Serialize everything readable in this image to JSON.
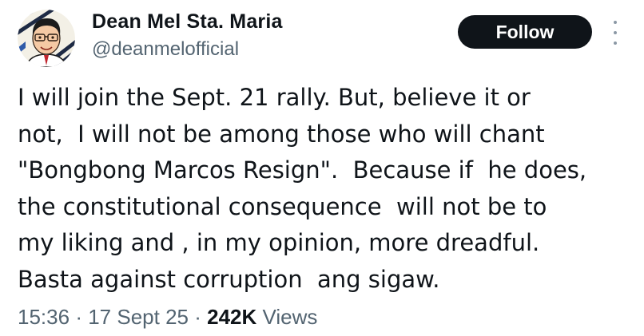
{
  "author": {
    "name": "Dean Mel Sta. Maria",
    "handle": "@deanmelofficial",
    "avatar_icon": "caricature-avatar-icon"
  },
  "actions": {
    "follow_label": "Follow",
    "more_icon": "more-vertical-icon"
  },
  "tweet": {
    "lines": [
      "I will join the Sept. 21 rally. But, believe it or",
      "not,  I will not be among those who will chant",
      "\"Bongbong Marcos Resign\".  Because if  he does,",
      "the constitutional consequence  will not be to",
      "my liking and , in my opinion, more dreadful.",
      "Basta against corruption  ang sigaw."
    ]
  },
  "meta": {
    "time": "15:36",
    "separator": "·",
    "date": "17 Sept 25",
    "views_count": "242K",
    "views_label": "Views"
  },
  "colors": {
    "text": "#0f1419",
    "secondary": "#536471",
    "button_bg": "#0f1419",
    "button_text": "#ffffff"
  }
}
